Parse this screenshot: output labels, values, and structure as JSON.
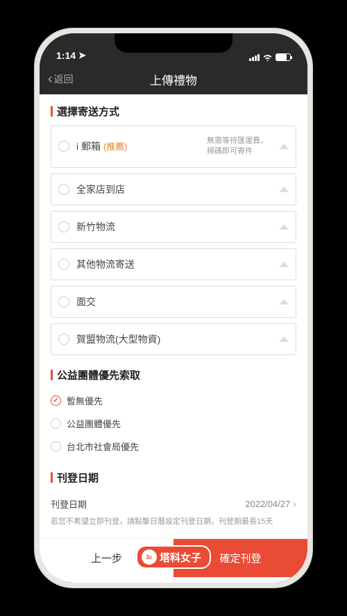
{
  "statusbar": {
    "time": "1:14"
  },
  "nav": {
    "back": "返回",
    "title": "上傳禮物"
  },
  "section_shipping": {
    "title": "選擇寄送方式",
    "options": [
      {
        "label": "i 郵箱",
        "recommend": "(推薦)",
        "desc1": "無需等待匯運費，",
        "desc2": "掃碼即可寄件"
      },
      {
        "label": "全家店到店"
      },
      {
        "label": "新竹物流"
      },
      {
        "label": "其他物流寄送"
      },
      {
        "label": "面交"
      },
      {
        "label": "賀盟物流(大型物資)"
      }
    ]
  },
  "section_priority": {
    "title": "公益團體優先索取",
    "items": [
      {
        "label": "暫無優先",
        "checked": true
      },
      {
        "label": "公益團體優先",
        "checked": false
      },
      {
        "label": "台北市社會局優先",
        "checked": false
      }
    ]
  },
  "section_date": {
    "title": "刊登日期",
    "label": "刊登日期",
    "value": "2022/04/27",
    "help": "若您不希望立即刊登，請點擊日曆設定刊登日期，刊登期最長15天"
  },
  "footer": {
    "prev": "上一步",
    "confirm": "確定刊登"
  },
  "badge": {
    "icon": "3c",
    "text": "塔科女子"
  }
}
